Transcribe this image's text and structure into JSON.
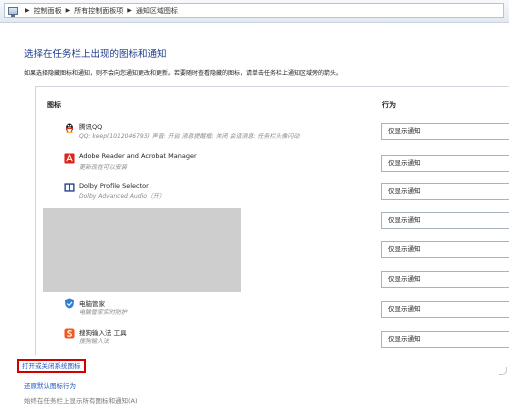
{
  "breadcrumb": {
    "items": [
      "控制面板",
      "所有控制面板项",
      "通知区域图标"
    ]
  },
  "page": {
    "title": "选择在任务栏上出现的图标和通知",
    "description": "如果选择隐藏图标和通知，则不会向您通知更改和更新。若要随时查看隐藏的图标，请单击任务栏上通知区域旁的箭头。"
  },
  "table": {
    "col_icon": "图标",
    "col_behavior": "行为",
    "rows": [
      {
        "name": "腾讯QQ",
        "sub": "QQ: keep(1012046793) 声音: 开启 消息提醒框: 关闭 会话消息: 任务栏头像闪动",
        "behavior": "仅显示通知",
        "icon": "qq-penguin-icon"
      },
      {
        "name": "Adobe Reader and Acrobat Manager",
        "sub": "更新现在可以安装",
        "behavior": "仅显示通知",
        "icon": "adobe-icon"
      },
      {
        "name": "Dolby Profile Selector",
        "sub": "Dolby Advanced Audio（开）",
        "behavior": "仅显示通知",
        "icon": "dolby-icon"
      },
      {
        "name": "",
        "sub": "",
        "behavior": "仅显示通知",
        "icon": ""
      },
      {
        "name": "",
        "sub": "",
        "behavior": "仅显示通知",
        "icon": ""
      },
      {
        "name": "",
        "sub": "",
        "behavior": "仅显示通知",
        "icon": ""
      },
      {
        "name": "电脑管家",
        "sub": "电脑管家实时防护",
        "behavior": "仅显示通知",
        "icon": "pc-manager-shield-icon"
      },
      {
        "name": "搜狗输入法 工具",
        "sub": "搜狗输入法",
        "behavior": "仅显示通知",
        "icon": "sogou-icon"
      }
    ]
  },
  "links": {
    "toggle_system_icons": "打开或关闭系统图标",
    "restore_defaults": "还原默认图标行为",
    "always_show": "始终在任务栏上显示所有图标和通知(A)"
  },
  "colors": {
    "title_blue": "#1c3a8a",
    "link_blue": "#1e56c2",
    "highlight_red": "#d40000"
  }
}
